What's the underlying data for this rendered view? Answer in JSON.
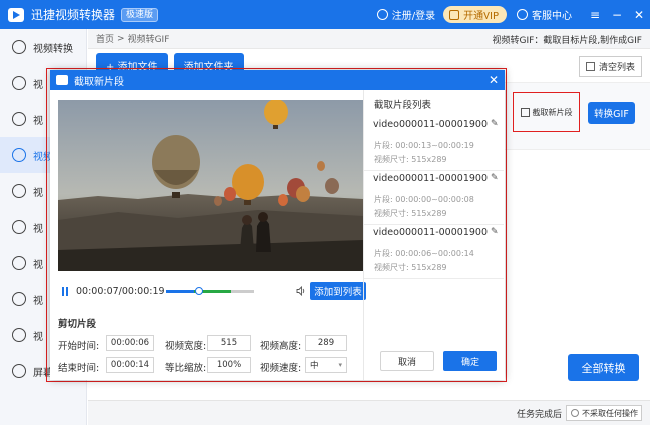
{
  "app": {
    "title": "迅捷视频转换器",
    "badge": "极速版"
  },
  "titlebar": {
    "login": "注册/登录",
    "vip": "开通VIP",
    "service": "客服中心"
  },
  "sidebar": {
    "items": [
      {
        "label": "视频转换"
      },
      {
        "label": "视"
      },
      {
        "label": "视"
      },
      {
        "label": "视频"
      },
      {
        "label": "视"
      },
      {
        "label": "视"
      },
      {
        "label": "视"
      },
      {
        "label": "视"
      },
      {
        "label": "视"
      },
      {
        "label": "屏幕"
      }
    ]
  },
  "breadcrumb": {
    "home": "首页",
    "separator": ">",
    "current": "视频转GIF",
    "hint": "视频转GIF：截取目标片段,制作成GIF"
  },
  "toolbar": {
    "add_file": "+ 添加文件",
    "add_folder": "添加文件夹",
    "clear_list": "清空列表"
  },
  "row": {
    "cut_new": "截取新片段",
    "to_gif": "转换GIF"
  },
  "convert_all": "全部转换",
  "status": {
    "label": "任务完成后",
    "option": "不采取任何操作"
  },
  "dialog": {
    "title": "截取新片段",
    "close": "✕",
    "time_display": "00:00:07/00:00:19",
    "seek": {
      "progress": 0.37,
      "clip_start": 0.32,
      "clip_end": 0.74
    },
    "add_to_list": "添加到列表",
    "section": "剪切片段",
    "fields": {
      "start_label": "开始时间:",
      "start_value": "00:00:06",
      "end_label": "结束时间:",
      "end_value": "00:00:14",
      "width_label": "视频宽度:",
      "width_value": "515",
      "scale_label": "等比缩放:",
      "scale_value": "100%",
      "height_label": "视频高度:",
      "height_value": "289",
      "speed_label": "视频速度:",
      "speed_value": "中"
    },
    "clip_list_title": "截取片段列表",
    "clips": [
      {
        "name": "video000011-000019000000...",
        "range_label": "片段:",
        "range": "00:00:13~00:00:19",
        "size_label": "视频尺寸:",
        "size": "515x289"
      },
      {
        "name": "video000011-000019000000...",
        "range_label": "片段:",
        "range": "00:00:00~00:00:08",
        "size_label": "视频尺寸:",
        "size": "515x289"
      },
      {
        "name": "video000011-000019000000...",
        "range_label": "片段:",
        "range": "00:00:06~00:00:14",
        "size_label": "视频尺寸:",
        "size": "515x289"
      }
    ],
    "cancel": "取消",
    "ok": "确定"
  }
}
